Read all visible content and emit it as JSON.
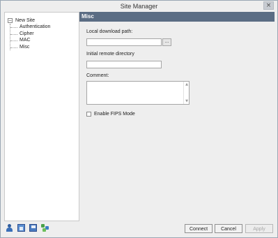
{
  "window": {
    "title": "Site Manager",
    "close_glyph": "×"
  },
  "tree": {
    "root": {
      "expander": "−",
      "label": "New Site"
    },
    "children": [
      "Authentication",
      "Cipher",
      "MAC",
      "Misc"
    ]
  },
  "panel": {
    "header": "Misc",
    "local_download_path": {
      "label": "Local download path:",
      "value": "",
      "browse_label": "..."
    },
    "initial_remote_directory": {
      "label": "Initial remote directory",
      "value": ""
    },
    "comment": {
      "label": "Comment:",
      "value": ""
    },
    "fips": {
      "label": "Enable FIPS Mode",
      "checked": false
    }
  },
  "toolbar_icons": [
    "person-icon",
    "window-icon",
    "save-icon",
    "network-icon"
  ],
  "buttons": {
    "connect": "Connect",
    "cancel": "Cancel",
    "apply": "Apply"
  },
  "colors": {
    "header_bg": "#5b6d84",
    "window_bg": "#eeeeee",
    "border": "#9aa7b4"
  }
}
